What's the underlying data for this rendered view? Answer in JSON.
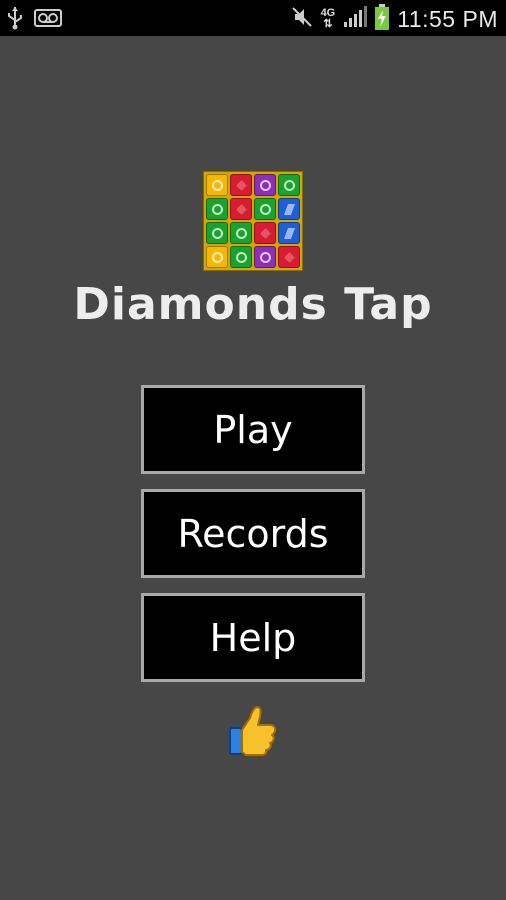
{
  "status_bar": {
    "time": "11:55 PM",
    "network": "4G",
    "icons": [
      "usb-icon",
      "voicemail-icon",
      "mute-icon",
      "data-arrows-icon",
      "signal-icon",
      "battery-charging-icon"
    ]
  },
  "app": {
    "title": "Diamonds Tap",
    "logo_colors": {
      "yellow": "#f4b800",
      "red": "#d81c32",
      "purple": "#8b2fb7",
      "green": "#19a22c",
      "blue": "#1f5fd6"
    },
    "logo_grid": [
      [
        "yellow",
        "red",
        "purple",
        "green"
      ],
      [
        "green",
        "red",
        "green",
        "blue"
      ],
      [
        "green",
        "green",
        "red",
        "blue"
      ],
      [
        "yellow",
        "green",
        "purple",
        "red"
      ]
    ]
  },
  "menu": {
    "play": "Play",
    "records": "Records",
    "help": "Help"
  },
  "like_button": {
    "icon": "thumbs-up-icon"
  }
}
